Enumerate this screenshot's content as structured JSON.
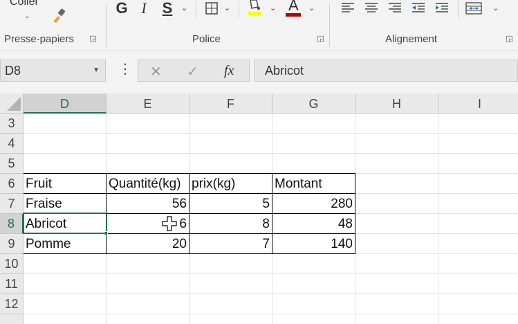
{
  "ribbon": {
    "clipboard": {
      "coller_label": "Coller",
      "group_label": "Presse-papiers"
    },
    "font": {
      "bold": "G",
      "italic": "I",
      "strike": "S",
      "font_color_glyph": "A",
      "group_label": "Police",
      "fill_color": "#ffff00",
      "font_color": "#c00000"
    },
    "alignment": {
      "group_label": "Alignement"
    }
  },
  "formula_bar": {
    "name_box": "D8",
    "fx_label": "fx",
    "value": "Abricot"
  },
  "columns": [
    "D",
    "E",
    "F",
    "G",
    "H",
    "I"
  ],
  "active_column": "D",
  "rows": [
    "3",
    "4",
    "5",
    "6",
    "7",
    "8",
    "9",
    "10",
    "11",
    "12"
  ],
  "active_row": "8",
  "table": {
    "headers": [
      "Fruit",
      "Quantité(kg)",
      "prix(kg)",
      "Montant"
    ],
    "rows": [
      [
        "Fraise",
        "56",
        "5",
        "280"
      ],
      [
        "Abricot",
        "6",
        "8",
        "48"
      ],
      [
        "Pomme",
        "20",
        "7",
        "140"
      ]
    ]
  },
  "colors": {
    "excel_green": "#217346"
  }
}
